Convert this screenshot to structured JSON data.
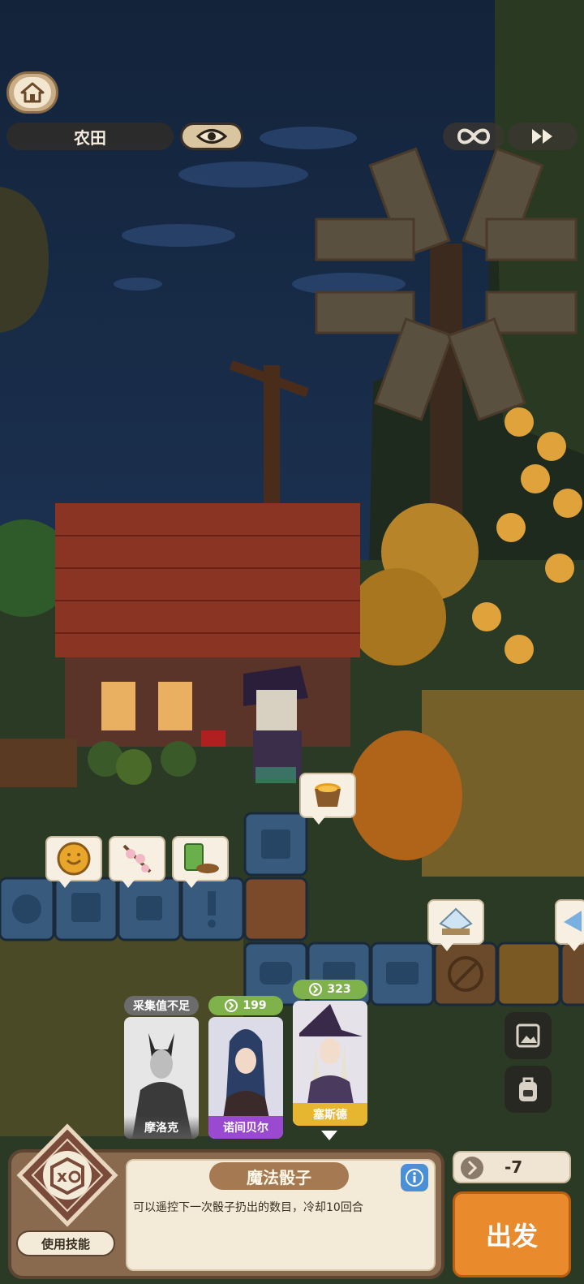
{
  "header": {
    "location_label": "农田"
  },
  "icons": {
    "home": "home-icon",
    "eye": "eye-icon",
    "infinite": "infinity-icon",
    "fast_forward": "fast-forward-icon"
  },
  "characters": [
    {
      "name": "摩洛克",
      "status": "采集值不足",
      "selected": false
    },
    {
      "name": "诺间贝尔",
      "value": "199",
      "selected": false
    },
    {
      "name": "塞斯德",
      "value": "323",
      "selected": true
    }
  ],
  "skill": {
    "title": "魔法骰子",
    "description": "可以遥控下一次骰子扔出的数目，冷却10回合",
    "use_label": "使用技能"
  },
  "resource": {
    "count": "-7"
  },
  "go_label": "出发",
  "colors": {
    "accent": "#e98a2d",
    "panel": "#8a6a4e",
    "value_badge": "#7fb24a"
  }
}
